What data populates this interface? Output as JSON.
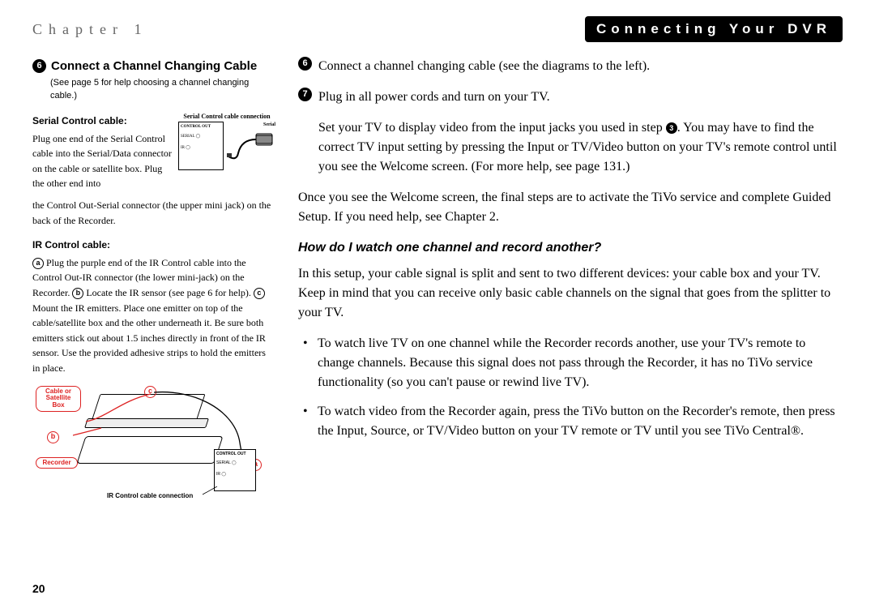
{
  "header": {
    "chapter": "Chapter 1",
    "title": "Connecting Your DVR"
  },
  "left": {
    "step6_num": "6",
    "step6_title": "Connect a Channel Changing Cable",
    "step6_note": "(See page 5 for help choosing a channel changing cable.)",
    "serial_title": "Serial Control cable:",
    "serial_diag_caption": "Serial Control cable connection",
    "serial_diag_label_serial": "Serial",
    "serial_diag_label_ctrlout": "CONTROL OUT",
    "serial_diag_label_serial2": "SERIAL",
    "serial_diag_label_ir": "IR",
    "serial_body": "Plug one end of the Serial Control cable into the Serial/Data connector on the cable or satellite box. Plug the other end into the Control Out-Serial connector (the upper mini jack) on the back of the Recorder.",
    "ir_title": "IR Control cable:",
    "ir_a": "a",
    "ir_a_text": " Plug the purple end of the IR Control cable into the Control Out-IR connector (the lower mini-jack) on the Recorder. ",
    "ir_b": "b",
    "ir_b_text": " Locate the IR sensor (see page 6 for help). ",
    "ir_c": "c",
    "ir_c_text": " Mount the IR emitters. Place one emitter on top of the cable/satellite box and the other underneath it. Be sure both emitters stick out about 1.5 inches directly in front of the IR sensor. Use the provided adhesive strips to hold the emitters in place.",
    "ir_diag": {
      "cable_box": "Cable or Satellite Box",
      "recorder": "Recorder",
      "b": "b",
      "c": "c",
      "a": "a",
      "caption": "IR Control cable connection",
      "ctrlout": "CONTROL OUT",
      "serial": "SERIAL",
      "ir": "IR"
    }
  },
  "right": {
    "step6_num": "6",
    "step6_text": "Connect a channel changing cable (see the diagrams to the left).",
    "step7_num": "7",
    "step7_text": "Plug in all power cords and turn on your TV.",
    "step7_cont_a": "Set your TV to display video from the input jacks you used in step ",
    "step7_cont_num": "3",
    "step7_cont_b": ". You may have to find the correct TV input setting by pressing the Input or TV/Video button on your TV's remote control until you see the Welcome screen. (For more help, see page 131.)",
    "welcome": "Once you see the Welcome screen, the final steps are to activate the TiVo service and complete Guided Setup. If you need help, see Chapter 2.",
    "q_heading": "How do I watch one channel and record another?",
    "q_body": "In this setup, your cable signal is split and sent to two different devices: your cable box and your TV. Keep in mind that you can receive only basic cable channels on the signal that goes from the splitter to your TV.",
    "bullet1": "To watch live TV on one channel while the Recorder records another, use your TV's remote to change channels. Because this signal does not pass through the Recorder, it has no TiVo service functionality (so you can't pause or rewind live TV).",
    "bullet2": "To watch video from the Recorder again, press the TiVo button on the Recorder's remote, then press the Input, Source, or TV/Video button on your TV remote or TV until you see TiVo Central®."
  },
  "page_number": "20"
}
